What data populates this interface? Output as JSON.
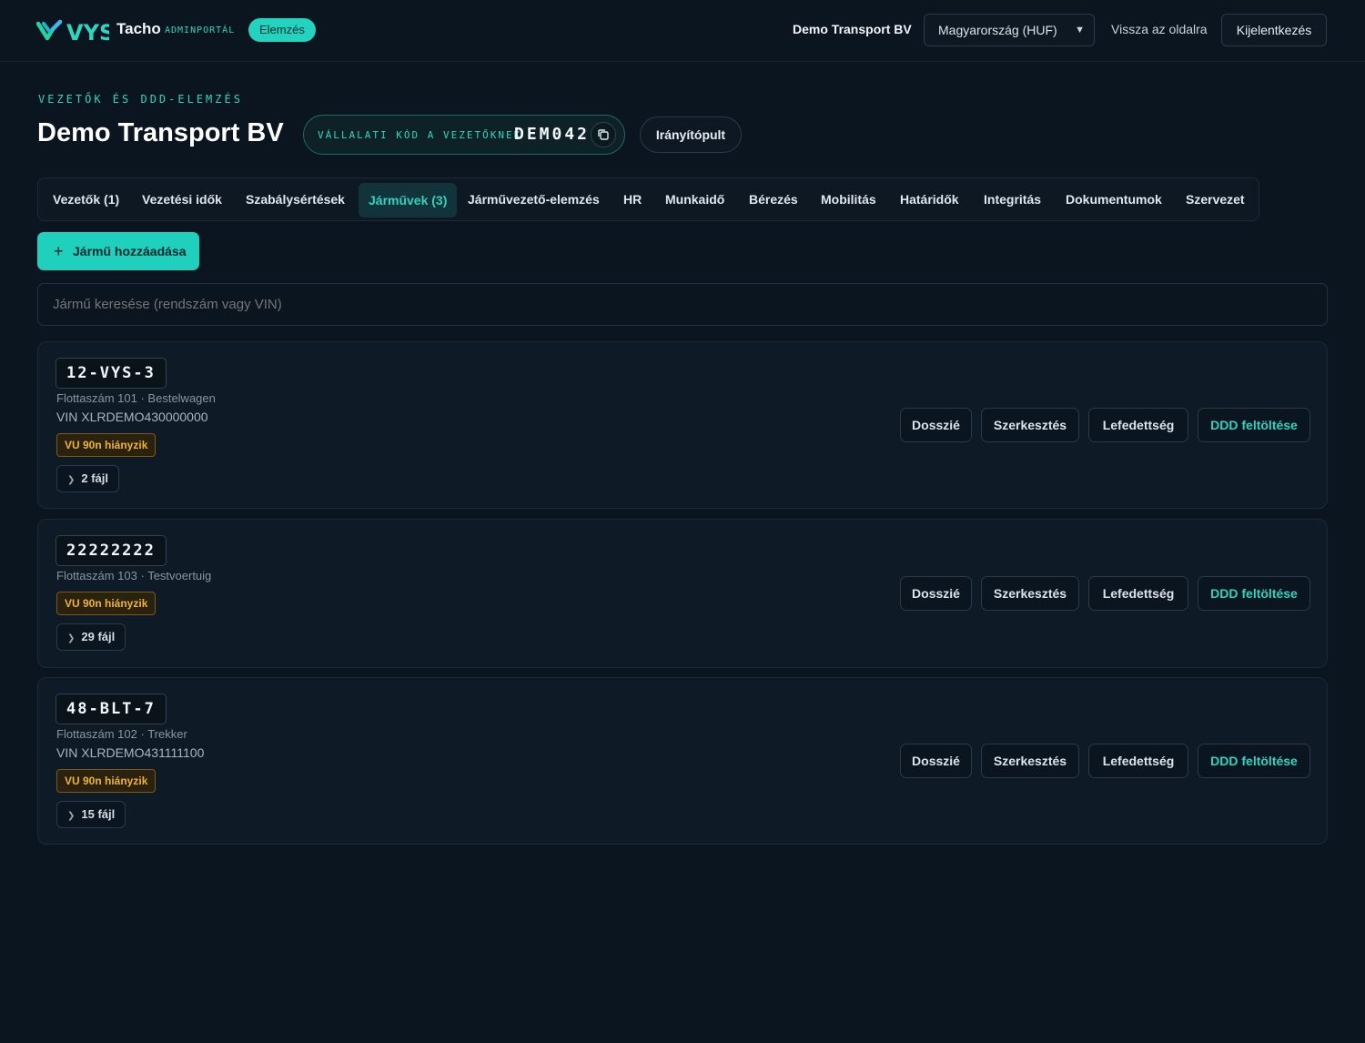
{
  "header": {
    "logo_text": "VYS",
    "brand": "Tacho",
    "brand_sub": "ADMINPORTÁL",
    "pill": "Elemzés",
    "company": "Demo Transport BV",
    "region_select": "Magyarország (HUF)",
    "back_link": "Vissza az oldalra",
    "logout": "Kijelentkezés"
  },
  "page": {
    "eyebrow": "VEZETŐK ÉS DDD-ELEMZÉS",
    "title": "Demo Transport BV",
    "code_label": "VÁLLALATI KÓD A VEZETŐKNEK",
    "code_value": "DEM042",
    "dashboard_button": "Irányítópult"
  },
  "tabs": [
    {
      "label": "Vezetők (1)",
      "active": false
    },
    {
      "label": "Vezetési idők",
      "active": false
    },
    {
      "label": "Szabálysértések",
      "active": false
    },
    {
      "label": "Járművek (3)",
      "active": true
    },
    {
      "label": "Járművezető-elemzés",
      "active": false
    },
    {
      "label": "HR",
      "active": false
    },
    {
      "label": "Munkaidő",
      "active": false
    },
    {
      "label": "Bérezés",
      "active": false
    },
    {
      "label": "Mobilitás",
      "active": false
    },
    {
      "label": "Határidők",
      "active": false
    },
    {
      "label": "Integritás",
      "active": false
    },
    {
      "label": "Dokumentumok",
      "active": false
    },
    {
      "label": "Szervezet",
      "active": false
    }
  ],
  "add_button": "Jármű hozzáadása",
  "search": {
    "placeholder": "Jármű keresése (rendszám vagy VIN)",
    "value": ""
  },
  "actions": {
    "dossier": "Dosszié",
    "edit": "Szerkesztés",
    "coverage": "Lefedettség",
    "ddd_upload": "DDD feltöltése"
  },
  "vehicles": [
    {
      "plate": "12-VYS-3",
      "meta": "Flottaszám 101 · Bestelwagen",
      "vin": "VIN XLRDEMO430000000",
      "badge": "VU 90n hiányzik",
      "files": "2 fájl"
    },
    {
      "plate": "22222222",
      "meta": "Flottaszám 103 · Testvoertuig",
      "vin": "",
      "badge": "VU 90n hiányzik",
      "files": "29 fájl"
    },
    {
      "plate": "48-BLT-7",
      "meta": "Flottaszám 102 · Trekker",
      "vin": "VIN XLRDEMO431111100",
      "badge": "VU 90n hiányzik",
      "files": "15 fájl"
    }
  ],
  "colors": {
    "background": "#0b1520",
    "accent": "#1fd0bd",
    "warning": "#f0b429"
  }
}
